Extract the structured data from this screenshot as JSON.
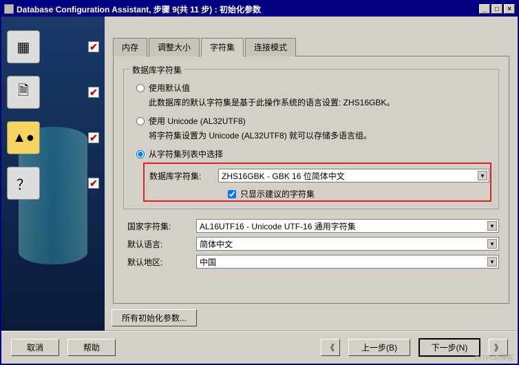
{
  "window": {
    "title": "Database Configuration Assistant, 步骤 9(共 11 步) : 初始化参数"
  },
  "tabs": {
    "memory": "内存",
    "sizing": "调整大小",
    "charset": "字符集",
    "connmode": "连接模式"
  },
  "group": {
    "legend": "数据库字符集"
  },
  "radios": {
    "default": "使用默认值",
    "default_hint": "此数据库的默认字符集是基于此操作系统的语言设置: ZHS16GBK。",
    "unicode": "使用 Unicode (AL32UTF8)",
    "unicode_hint": "将字符集设置为 Unicode (AL32UTF8) 就可以存储多语言组。",
    "fromlist": "从字符集列表中选择"
  },
  "fields": {
    "db_charset_label": "数据库字符集:",
    "db_charset_value": "ZHS16GBK - GBK 16 位简体中文",
    "only_recommended": "只显示建议的字符集",
    "national_label": "国家字符集:",
    "national_value": "AL16UTF16 - Unicode UTF-16 通用字符集",
    "lang_label": "默认语言:",
    "lang_value": "简体中文",
    "region_label": "默认地区:",
    "region_value": "中国"
  },
  "buttons": {
    "all_params": "所有初始化参数...",
    "cancel": "取消",
    "help": "帮助",
    "back": "上一步(B)",
    "next": "下一步(N)"
  },
  "watermark": "©ITPUB博客"
}
